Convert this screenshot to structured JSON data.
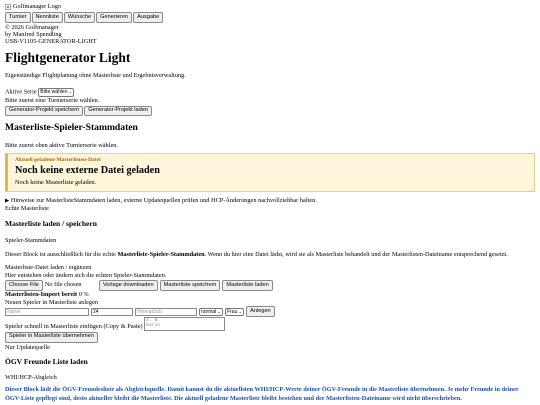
{
  "header": {
    "logo_alt": "Golfmanager Logo",
    "nav_buttons": [
      "Turnier",
      "Nennliste",
      "Wünsche",
      "Generieren",
      "Ausgabe"
    ],
    "copyright": "© 2026 Golfmanager",
    "author": "by Manfred Spendling",
    "usb_id": "USB-V1105-GENERATOR-LIGHT"
  },
  "page": {
    "title": "Flightgenerator Light",
    "subtitle": "Eigenständige Flightplanung ohne Masterliste und Ergebnisverwaltung.",
    "series_label": "Aktive Serie",
    "series_select": "Bitte wählen",
    "series_hint": "Bitte zuerst eine Turnierserie wählen.",
    "save_project": "Generator-Projekt speichern",
    "load_project": "Generator-Projekt laden"
  },
  "master": {
    "heading": "Masterliste-Spieler-Stammdaten",
    "hint": "Bitte zuerst oben aktive Turnierserie wählen.",
    "alert": {
      "eyebrow": "Aktuell geladene Masterlisten-Datei",
      "headline": "Noch keine externe Datei geladen",
      "text": "Noch keine Masterliste geladen."
    },
    "details_summary": "Hinweise zur MasterlisteStammdaten laden, externe Updatequellen prüfen und HCP-Änderungen nachvollziehbar halten.",
    "echte_label": "Echte Masterliste",
    "load_heading": "Masterliste laden / speichern",
    "stamm_label": "Spieler-Stammdaten",
    "desc_pre": "Dieser Block ist ausschließlich für die echte ",
    "desc_bold": "Masterliste-Spieler-Stammdaten",
    "desc_post": ". Wenn du hier eine Datei lädst, wird sie als Masterliste behandelt und der Masterlisten-Dateiname entsprechend gesetzt.",
    "file_label": "Masterliste-Datei laden / ergänzen",
    "file_hint": "Hier entstehen oder ändern sich die echten Spieler-Stammdaten.",
    "choose_file": "Choose File",
    "no_file": "No file chosen",
    "btn_template": "Vorlage downloaden",
    "btn_save": "Masterliste speichern",
    "btn_load": "Masterliste laden",
    "import_label": "Masterlisten-Import bereit",
    "import_value": "0 %",
    "new_player_label": "Neuen Spieler in Masterliste anlegen",
    "ph_name": "Name",
    "hcp_value": "24",
    "ph_club": "Heimatclub",
    "sel_type": "normal",
    "sel_gender": "Frau",
    "btn_add": "Anlegen",
    "quick_label": "Spieler schnell in Masterliste einfügen (Copy & Paste)",
    "textarea_ph": "z. B.\nKarin",
    "btn_take": "Spieler in Masterliste übernehmen",
    "only_update": "Nur Updatequelle"
  },
  "oegv": {
    "heading": "ÖGV Freunde Liste laden",
    "sub": "WHI/HCP-Abgleich",
    "text": "Dieser Block lädt die ÖGV-Freundesliste als Abgleichquelle. Damit kannst du die aktuellsten WHI/HCP-Werte deiner ÖGV-Freunde in die Masterliste übernehmen. Je mehr Freunde in deiner ÖGV-Liste gepflegt sind, desto aktueller bleibt die Masterliste. Die aktuell geladene Masterliste bleibt bestehen und der Masterlisten-Dateiname wird nicht überschrieben."
  },
  "colors": {
    "alert_bg": "#fdf5dc",
    "alert_border": "#e3b842",
    "eyebrow": "#a06a00",
    "info_blue": "#1f4fa6"
  }
}
